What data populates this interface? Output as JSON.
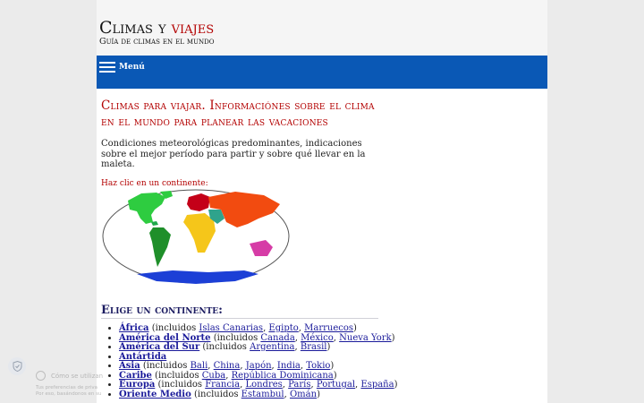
{
  "site": {
    "title_part1": "Climas y ",
    "title_part2": "viajes",
    "tagline": "Guía de climas en el mundo"
  },
  "nav": {
    "menu_label": "Menú",
    "icon": "hamburger-menu-icon"
  },
  "main": {
    "title": "Climas para viajar. Informaciónes sobre el clima en el mundo para planear las vacaciones",
    "intro": "Condiciones meteorológicas predominantes, indicaciones sobre el mejor período para partir y sobre qué llevar en la maleta.",
    "click_hint": "Haz clic en un continente:",
    "section_title": "Elige un continente:"
  },
  "map_regions": [
    {
      "name": "north-america",
      "color": "#2ecc40"
    },
    {
      "name": "south-america",
      "color": "#1f8f2a"
    },
    {
      "name": "europe",
      "color": "#c40018"
    },
    {
      "name": "africa",
      "color": "#f5c61a"
    },
    {
      "name": "middle-east",
      "color": "#2fa38c"
    },
    {
      "name": "asia",
      "color": "#f24b10"
    },
    {
      "name": "oceania",
      "color": "#d63ca6"
    },
    {
      "name": "antarctica",
      "color": "#1c3fd6"
    }
  ],
  "continents": [
    {
      "name": "África",
      "prefix": " (incluidos ",
      "links": [
        "Islas Canarias",
        "Egipto",
        "Marruecos"
      ],
      "suffix": ")"
    },
    {
      "name": "América del Norte",
      "prefix": " (incluidos ",
      "links": [
        "Canada",
        "México",
        "Nueva York"
      ],
      "suffix": ")"
    },
    {
      "name": "América del Sur",
      "prefix": " (incluidos ",
      "links": [
        "Argentina",
        "Brasil"
      ],
      "suffix": ")"
    },
    {
      "name": "Antártida",
      "prefix": "",
      "links": [],
      "suffix": ""
    },
    {
      "name": "Asia",
      "prefix": " (incluidos ",
      "links": [
        "Bali",
        "China",
        "Japón",
        "India",
        "Tokio"
      ],
      "suffix": ")"
    },
    {
      "name": "Caribe",
      "prefix": " (incluidos ",
      "links": [
        "Cuba",
        "República Dominicana"
      ],
      "suffix": ")"
    },
    {
      "name": "Europa",
      "prefix": " (incluidos ",
      "links": [
        "Francia",
        "Londres",
        "París",
        "Portugal",
        "España"
      ],
      "suffix": ")"
    },
    {
      "name": "Oriente Medio",
      "prefix": " (incluidos ",
      "links": [
        "Estambul",
        "Omán"
      ],
      "suffix": ")"
    }
  ],
  "cookie": {
    "heading": "Cómo se utilizan",
    "line1": "Tus preferencias de priva",
    "line2": "Por eso, basándonos en su"
  }
}
